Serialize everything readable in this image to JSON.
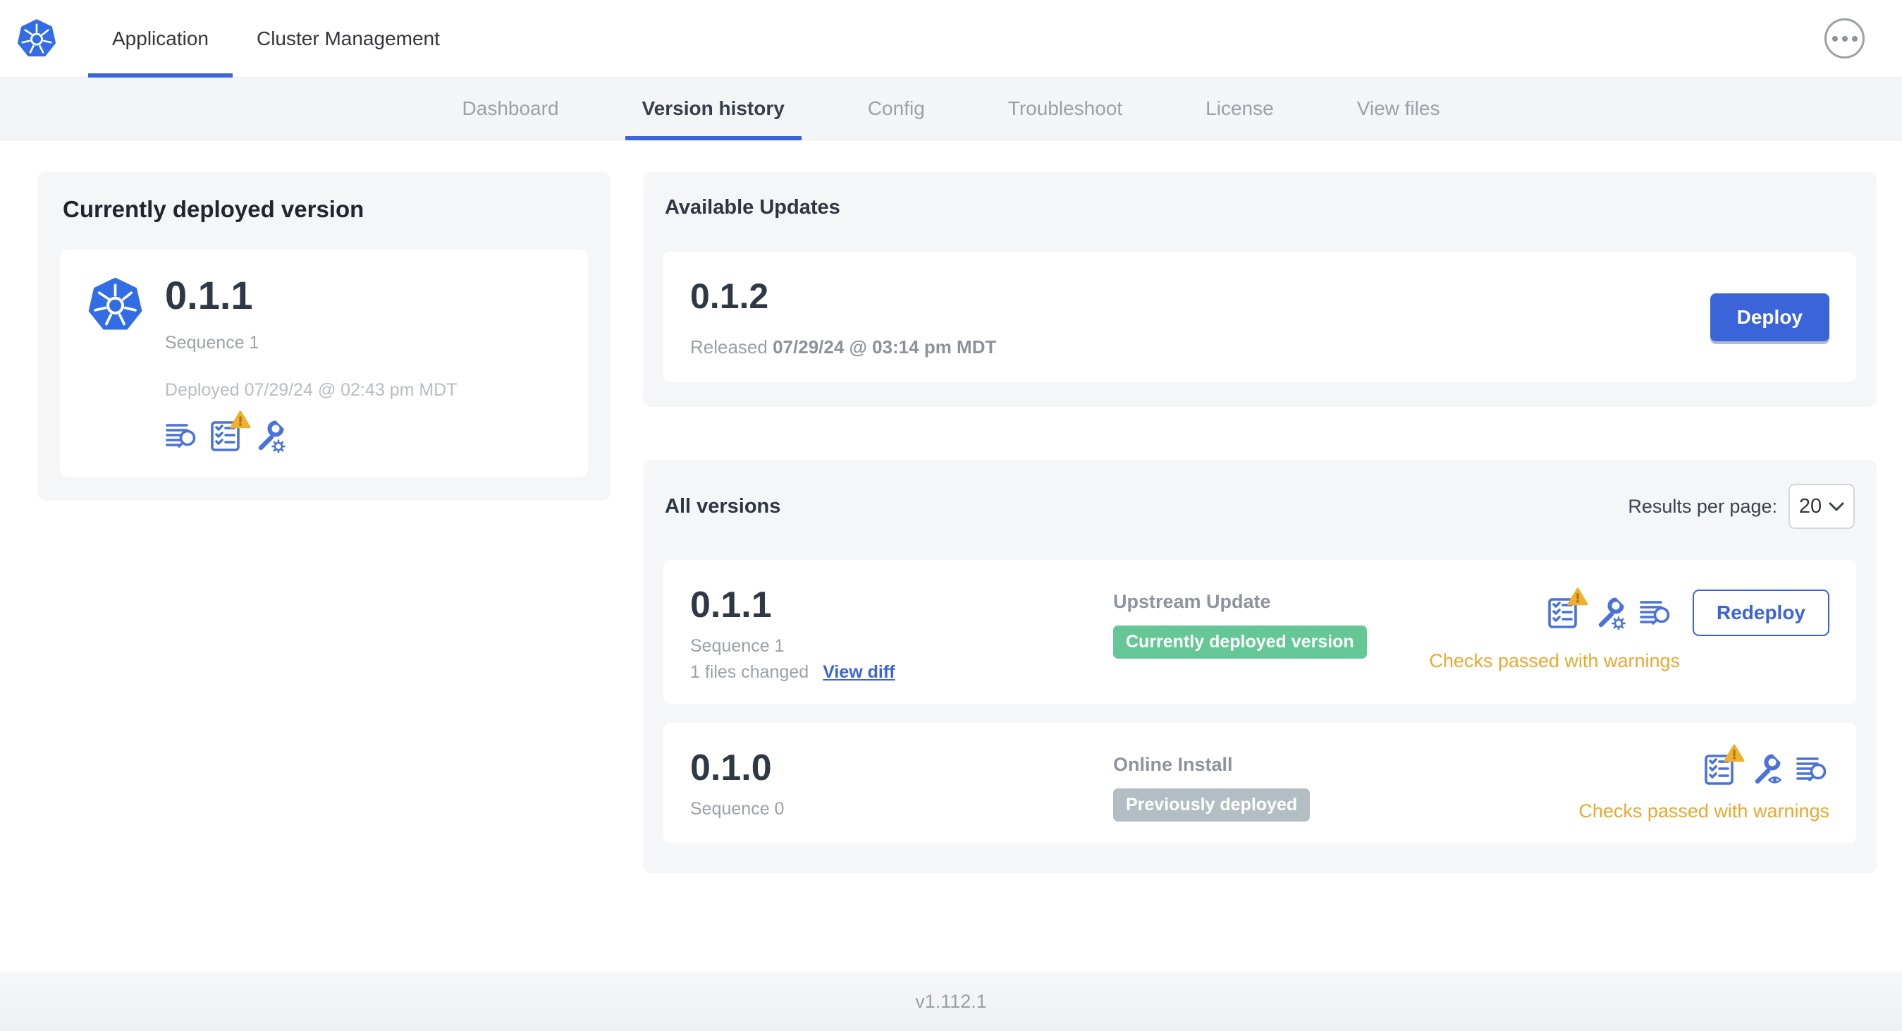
{
  "header": {
    "tabs": [
      {
        "label": "Application",
        "active": true
      },
      {
        "label": "Cluster Management",
        "active": false
      }
    ]
  },
  "subnav": {
    "active": "Version history",
    "tabs": [
      "Dashboard",
      "Version history",
      "Config",
      "Troubleshoot",
      "License",
      "View files"
    ]
  },
  "deployed_card": {
    "title": "Currently deployed version",
    "version": "0.1.1",
    "sequence": "Sequence 1",
    "deployed": "Deployed 07/29/24 @ 02:43 pm MDT"
  },
  "available_updates": {
    "title": "Available Updates",
    "version": "0.1.2",
    "released_label": "Released",
    "released_date": "07/29/24 @ 03:14 pm MDT",
    "deploy_label": "Deploy"
  },
  "all_versions": {
    "title": "All versions",
    "results_per_page_label": "Results per page:",
    "page_size": "20",
    "rows": [
      {
        "version": "0.1.1",
        "sequence": "Sequence 1",
        "files_changed": "1 files changed",
        "view_diff_label": "View diff",
        "source": "Upstream Update",
        "badge": "Currently deployed version",
        "badge_color": "#66c796",
        "status": "Checks passed with warnings",
        "action_label": "Redeploy"
      },
      {
        "version": "0.1.0",
        "sequence": "Sequence 0",
        "source": "Online Install",
        "badge": "Previously deployed",
        "badge_color": "#b3bec4",
        "status": "Checks passed with warnings"
      }
    ]
  },
  "footer": {
    "app_version": "v1.112.1"
  },
  "icons": {
    "kubernetes_logo": "blue-heptagon-helm-wheel",
    "more_options": "ellipsis-in-circle",
    "logs": "lines-with-magnifier",
    "preflight": "checklist",
    "warning": "amber-triangle-exclamation",
    "edit_config": "wrench-with-gear",
    "view_config": "wrench-with-eye",
    "chevron_down": "chevron"
  },
  "colors": {
    "accent": "#3b64d8",
    "icon_blue": "#4a72db",
    "green_badge": "#66c796",
    "gray_badge": "#b3bec4",
    "warning_amber": "#eaa82f"
  }
}
